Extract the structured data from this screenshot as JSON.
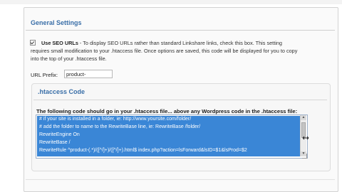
{
  "settings": {
    "heading": "General Settings",
    "seo_checkbox_label": "Use SEO URLs",
    "seo_description_line1": " - To display SEO URLs rather than standard Linkshare links, check this box. This setting",
    "seo_description_line2": "requires small modification to your .htaccess file. Once options are saved, this code will be displayed for you to copy",
    "seo_description_line3": "into the top of your .htaccess file.",
    "url_prefix_label": "URL Prefix:",
    "url_prefix_value": "product-"
  },
  "htaccess": {
    "title": ".htaccess Code",
    "intro": "The following code should go in your .htaccess file... above any Wordpress code in the .htaccess file:",
    "lines": [
      "# if your site is installed in a folder, ie: http://www.yoursite.com/folder/",
      "# add the folder to name to the RewriteBase line, ie: RewriteBase /folder/",
      "RewriteEngine On",
      "RewriteBase /",
      "RewriteRule ^product-(.*)/([^/]+)/([^/]+).html$ index.php?action=lsForward&lsID=$1&lsProd=$2"
    ]
  },
  "colors": {
    "heading": "#3a6fa8",
    "selection": "#3a86d6"
  }
}
